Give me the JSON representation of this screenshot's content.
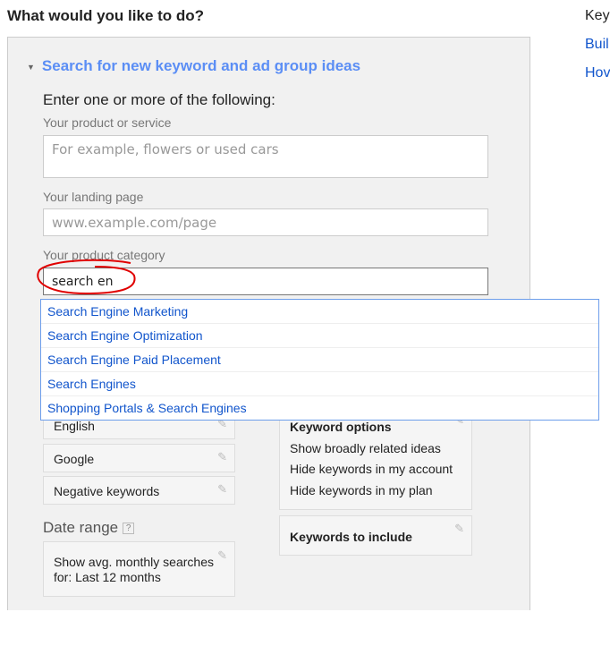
{
  "heading": "What would you like to do?",
  "sidebar": {
    "items": [
      "Key",
      "Buil",
      "Hov"
    ]
  },
  "section": {
    "title": "Search for new keyword and ad group ideas",
    "instructions": "Enter one or more of the following:"
  },
  "fields": {
    "product": {
      "label": "Your product or service",
      "placeholder": "For example, flowers or used cars"
    },
    "landing": {
      "label": "Your landing page",
      "placeholder": "www.example.com/page"
    },
    "category": {
      "label": "Your product category",
      "value": "search en"
    }
  },
  "suggestions": [
    "Search Engine Marketing",
    "Search Engine Optimization",
    "Search Engine Paid Placement",
    "Search Engines",
    "Shopping Portals & Search Engines"
  ],
  "targeting": {
    "language": "English",
    "network": "Google",
    "negative": "Negative keywords"
  },
  "date_range": {
    "label": "Date range",
    "help": "?",
    "value": "Show avg. monthly searches for: Last 12 months"
  },
  "keyword_options": {
    "title": "Keyword options",
    "items": [
      "Show broadly related ideas",
      "Hide keywords in my account",
      "Hide keywords in my plan"
    ]
  },
  "keywords_include": {
    "title": "Keywords to include"
  },
  "colors": {
    "link": "#1155cc",
    "section": "#5b8ef5",
    "annotation": "#e00000"
  }
}
